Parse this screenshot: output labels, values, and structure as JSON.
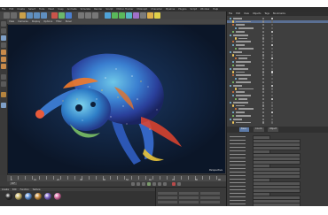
{
  "app": {
    "menu": [
      "File",
      "Edit",
      "Create",
      "Select",
      "Tools",
      "Mesh",
      "Snap",
      "Animate",
      "Simulate",
      "Render",
      "Sculpt",
      "Motion Tracker",
      "MoGraph",
      "Character",
      "Pipeline",
      "Plugins",
      "Script",
      "Window",
      "Help"
    ],
    "layout": "Startup"
  },
  "viewport": {
    "menu": [
      "View",
      "Cameras",
      "Display",
      "Options",
      "Filter",
      "Panel"
    ],
    "label": "Perspective"
  },
  "timeline": {
    "ticks": [
      "0",
      "10",
      "20",
      "30",
      "40",
      "50",
      "60",
      "70",
      "80",
      "90"
    ],
    "current_frame": "0 F"
  },
  "materials": {
    "menu": [
      "Create",
      "Edit",
      "Function",
      "Texture"
    ],
    "swatches": [
      "#2c2c2c",
      "#c9b56a",
      "#5b8fd6",
      "#c78c3a",
      "#7a62c7",
      "#d66aa0"
    ]
  },
  "coordinates": {
    "rows": [
      "X",
      "Y",
      "Z"
    ]
  },
  "object_manager": {
    "menu": [
      "File",
      "Edit",
      "View",
      "Objects",
      "Tags",
      "Bookmarks"
    ],
    "items": [
      {
        "color": "#7ec1e6"
      },
      {
        "color": "#f1c85a"
      },
      {
        "color": "#e47a3c"
      },
      {
        "color": "#7ec1e6"
      },
      {
        "color": "#88d46a"
      },
      {
        "color": "#7ec1e6"
      },
      {
        "color": "#f1c85a"
      },
      {
        "color": "#e47a3c"
      },
      {
        "color": "#7ec1e6"
      },
      {
        "color": "#88d46a"
      },
      {
        "color": "#7ec1e6"
      },
      {
        "color": "#f1c85a"
      },
      {
        "color": "#e47a3c"
      },
      {
        "color": "#7ec1e6"
      },
      {
        "color": "#88d46a"
      },
      {
        "color": "#7ec1e6"
      },
      {
        "color": "#f1c85a"
      },
      {
        "color": "#e47a3c"
      },
      {
        "color": "#7ec1e6"
      },
      {
        "color": "#88d46a"
      },
      {
        "color": "#7ec1e6"
      },
      {
        "color": "#f1c85a"
      },
      {
        "color": "#e47a3c"
      },
      {
        "color": "#7ec1e6"
      },
      {
        "color": "#88d46a"
      },
      {
        "color": "#7ec1e6"
      },
      {
        "color": "#f1c85a"
      },
      {
        "color": "#e47a3c"
      },
      {
        "color": "#7ec1e6"
      },
      {
        "color": "#88d46a"
      },
      {
        "color": "#7ec1e6"
      },
      {
        "color": "#f1c85a"
      }
    ]
  },
  "attributes": {
    "tabs": [
      "Basic",
      "Coord.",
      "Object"
    ],
    "rows": 20
  },
  "status": ""
}
